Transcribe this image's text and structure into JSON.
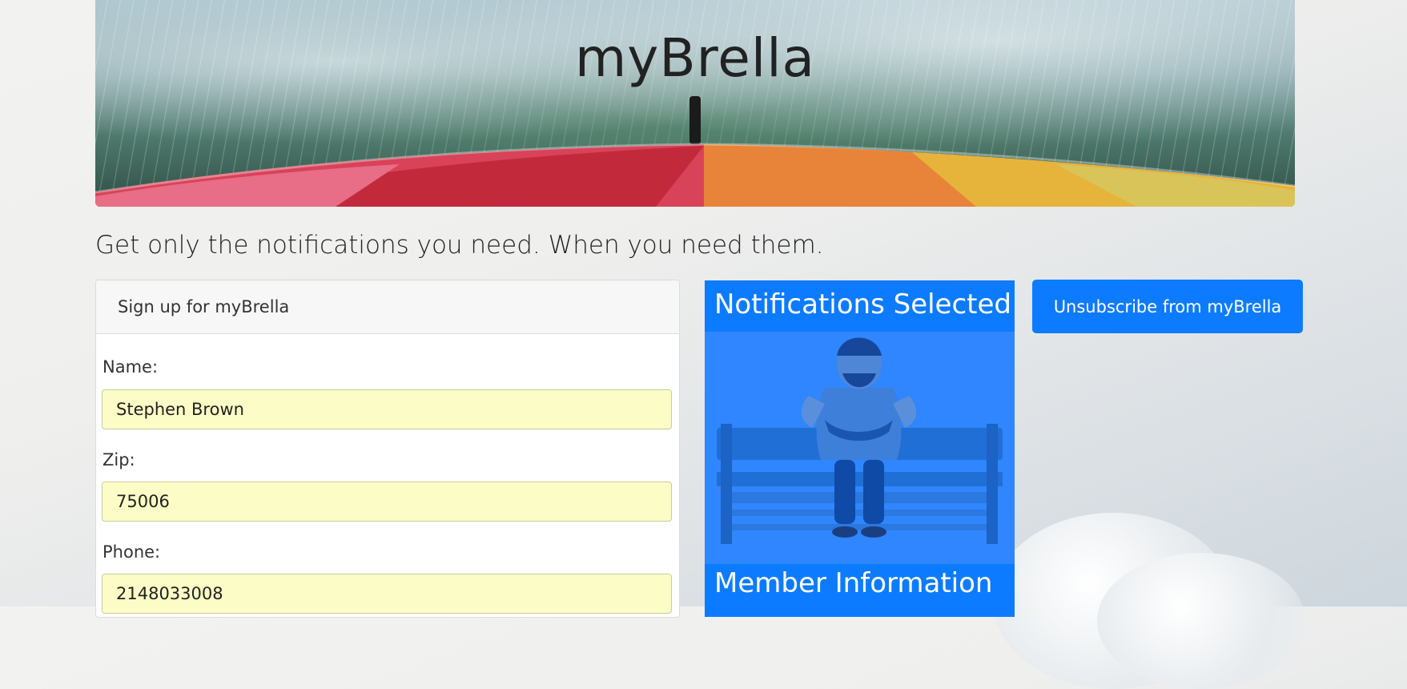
{
  "banner": {
    "title": "myBrella"
  },
  "tagline": "Get only the notifications you need. When you need them.",
  "signup": {
    "header": "Sign up for myBrella",
    "fields": [
      {
        "label": "Name:",
        "value": "Stephen Brown"
      },
      {
        "label": "Zip:",
        "value": "75006"
      },
      {
        "label": "Phone:",
        "value": "2148033008"
      }
    ]
  },
  "notifications": {
    "title": "Notifications Selected:",
    "member_title": "Member Information"
  },
  "unsubscribe_label": "Unsubscribe from myBrella",
  "colors": {
    "primary": "#0d7bff",
    "panel": "#2f86ff",
    "input_bg": "#fcfdc6"
  }
}
